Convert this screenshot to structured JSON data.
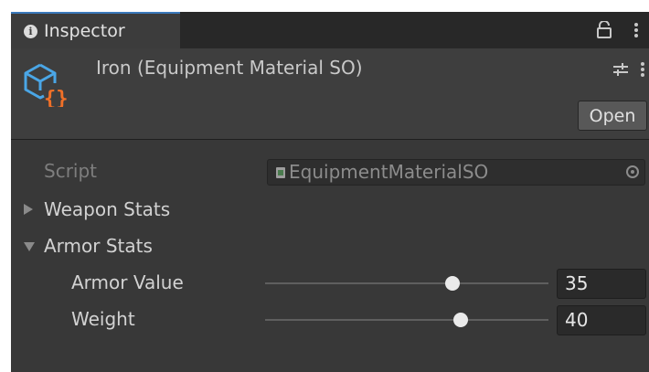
{
  "tab": {
    "label": "Inspector"
  },
  "header": {
    "title": "Iron (Equipment Material SO)",
    "open_label": "Open"
  },
  "properties": {
    "script": {
      "label": "Script",
      "value": "EquipmentMaterialSO"
    },
    "weapon_stats": {
      "label": "Weapon Stats",
      "expanded": false
    },
    "armor_stats": {
      "label": "Armor Stats",
      "expanded": true,
      "armor_value": {
        "label": "Armor Value",
        "value": "35",
        "slider_fraction": 0.66
      },
      "weight": {
        "label": "Weight",
        "value": "40",
        "slider_fraction": 0.69
      }
    }
  },
  "icons": {
    "tab": "info-icon",
    "lock": "lock-icon",
    "object": "scriptable-object-icon",
    "settings": "preset-settings-icon",
    "menu": "kebab-menu-icon",
    "picker": "object-picker-icon"
  },
  "colors": {
    "accent_tab": "#3a79bb",
    "so_icon_blue": "#4aa6e6",
    "so_icon_orange": "#f07028",
    "background": "#383838"
  }
}
